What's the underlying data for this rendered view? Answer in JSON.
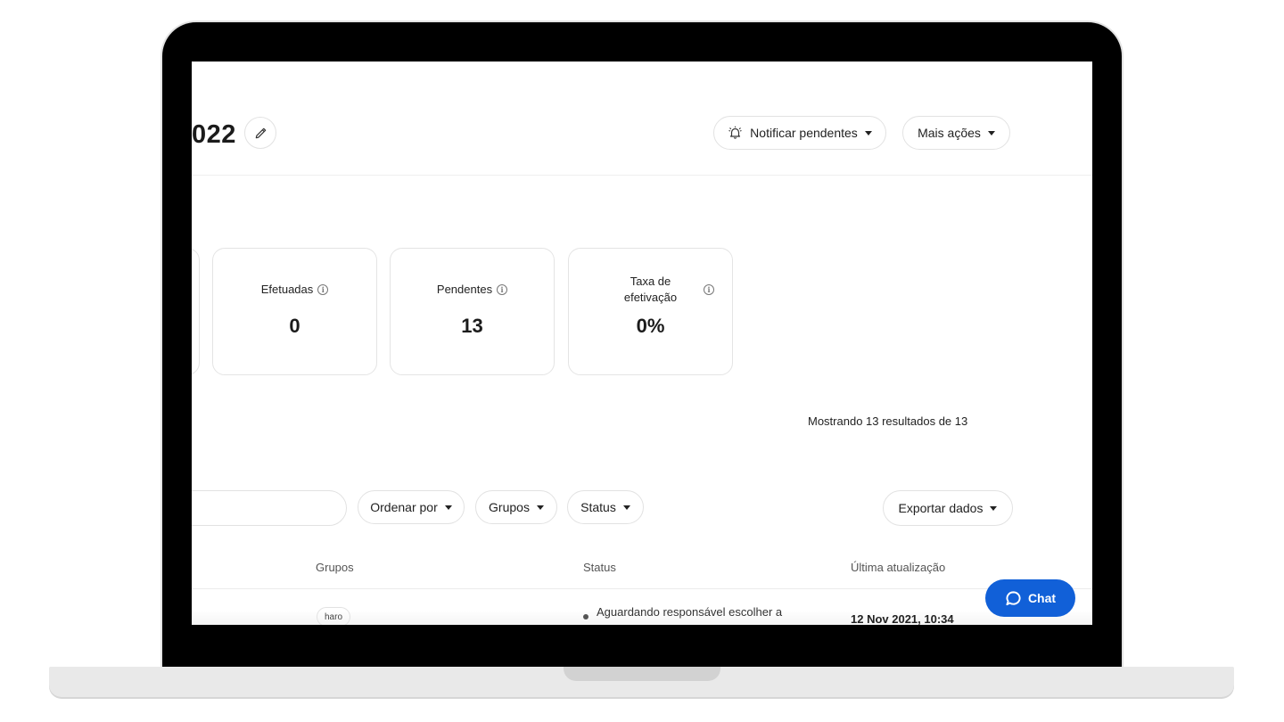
{
  "header": {
    "title": "022",
    "notify_label": "Notificar pendentes",
    "more_actions_label": "Mais ações"
  },
  "cards": [
    {
      "label": "Efetuadas",
      "value": "0"
    },
    {
      "label": "Pendentes",
      "value": "13"
    },
    {
      "label": "Taxa de efetivação",
      "value": "0%"
    }
  ],
  "results_text": "Mostrando 13 resultados de 13",
  "filters": {
    "sort_label": "Ordenar por",
    "groups_label": "Grupos",
    "status_label": "Status",
    "export_label": "Exportar dados"
  },
  "table": {
    "columns": [
      "Grupos",
      "Status",
      "Última atualização"
    ],
    "rows": [
      {
        "group": "haro",
        "status": "Aguardando responsável escolher a",
        "updated": "12 Nov 2021, 10:34"
      }
    ]
  },
  "chat": {
    "label": "Chat"
  },
  "colors": {
    "accent": "#1160d8"
  }
}
